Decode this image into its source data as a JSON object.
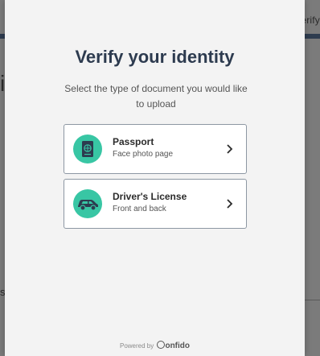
{
  "background": {
    "right_fragment": "erify",
    "left_fragment": "i",
    "left_small": "s"
  },
  "modal": {
    "title": "Verify your identity",
    "subtitle": "Select the type of document you would like to upload",
    "options": [
      {
        "title": "Passport",
        "subtitle": "Face photo page",
        "icon": "passport-icon"
      },
      {
        "title": "Driver's License",
        "subtitle": "Front and back",
        "icon": "car-icon"
      }
    ],
    "footer": {
      "powered_by": "Powered by",
      "brand": "onfido"
    }
  },
  "colors": {
    "accent": "#38c6a4",
    "title": "#2d3b4f",
    "overlay": "#7b7b7b"
  }
}
